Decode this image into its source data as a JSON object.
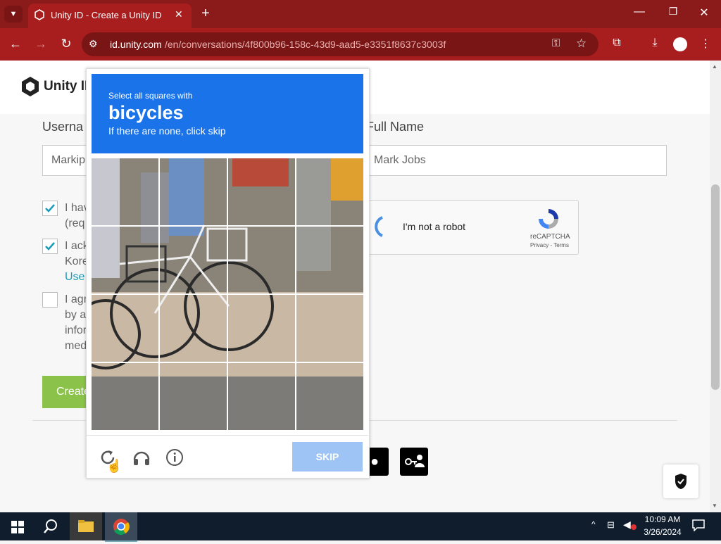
{
  "browser": {
    "tab_title": "Unity ID - Create a Unity ID",
    "url_host": "id.unity.com",
    "url_path": "/en/conversations/4f800b96-158c-43d9-aad5-e3351f8637c3003f"
  },
  "page": {
    "logo_text": "Unity ID",
    "username_label": "Userna",
    "username_value": "Markip",
    "fullname_label": "Full Name",
    "fullname_value": "Mark Jobs",
    "check1_line1": "I hav",
    "check1_line2": "(req",
    "check2_line1": "I ack",
    "check2_line2": "Kore",
    "check2_link": "Use",
    "check3_line1": "I agr",
    "check3_line2": "by a",
    "check3_line3": "infor",
    "check3_line4": "med",
    "create_button": "Create",
    "recaptcha_text": "I'm not a robot",
    "recaptcha_brand": "reCAPTCHA",
    "recaptcha_links": "Privacy - Terms"
  },
  "captcha": {
    "instruction": "Select all squares with",
    "target": "bicycles",
    "hint": "If there are none, click skip",
    "skip_label": "SKIP"
  },
  "taskbar": {
    "time": "10:09 AM",
    "date": "3/26/2024"
  },
  "colors": {
    "chrome_red": "#a81e1e",
    "captcha_blue": "#1a73e8",
    "create_green": "#8bc34a"
  }
}
